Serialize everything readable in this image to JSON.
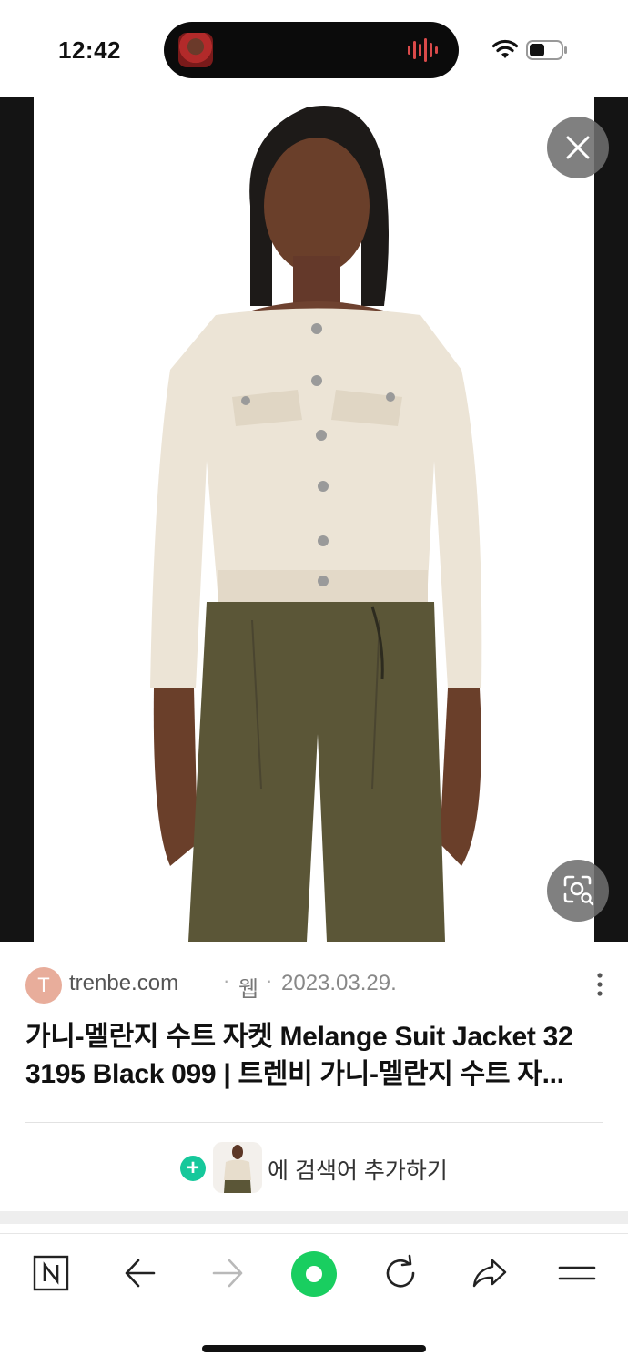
{
  "status_bar": {
    "time": "12:42",
    "icons": [
      "live-activity-thumbnail",
      "audio-wave-icon",
      "wifi-icon",
      "battery-icon"
    ],
    "wave_color": "#d94a4a"
  },
  "viewer": {
    "image_subject": "Model wearing cream off-shoulder denim jacket and olive trousers",
    "close_icon": "close-icon",
    "lens_icon": "image-search-icon"
  },
  "result": {
    "source_initial": "T",
    "source_domain": "trenbe.com",
    "separator": "·",
    "source_type": "웹",
    "date": "2023.03.29.",
    "title": "가니-멜란지 수트 자켓 Melange Suit Jacket 32 3195 Black 099 | 트렌비 가니-멜란지 수트 자...",
    "add_search_label": "에 검색어 추가하기"
  },
  "toolbar": {
    "items": [
      "naver-home-icon",
      "back-arrow-icon",
      "forward-arrow-icon",
      "green-dot-icon",
      "refresh-icon",
      "share-icon",
      "menu-icon"
    ],
    "accent": "#19ce60"
  }
}
